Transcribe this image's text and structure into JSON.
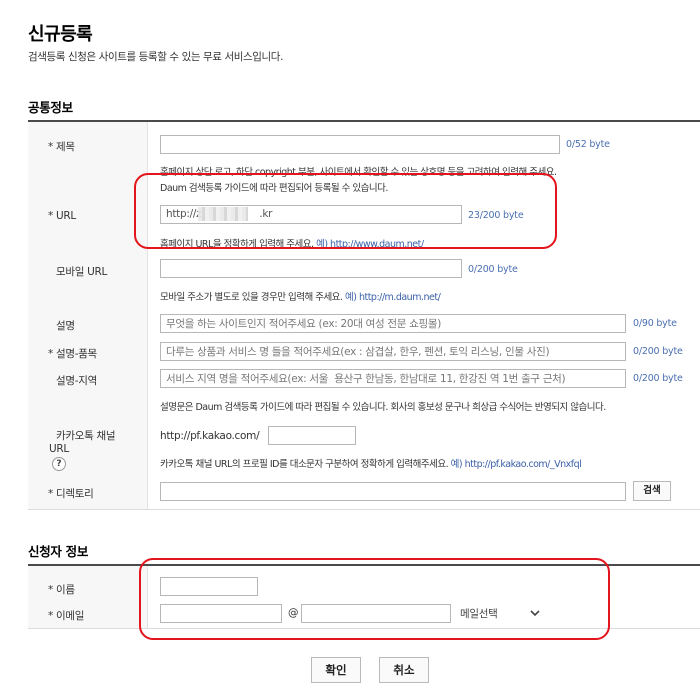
{
  "page": {
    "title": "신규등록",
    "subtitle": "검색등록 신청은 사이트를 등록할 수 있는 무료 서비스입니다."
  },
  "common": {
    "section_title": "공통정보",
    "title_field": {
      "label": "* 제목",
      "value": "",
      "counter": "0/52 byte",
      "help1": "홈페이지 상단 로고, 하단 copyright 부분, 사이트에서 확인할 수 있는 상호명 등을 고려하여 입력해 주세요.",
      "help2": "Daum 검색등록 가이드에 따라 편집되어 등록될 수 있습니다."
    },
    "url_field": {
      "label": "* URL",
      "value_prefix": "http://z",
      "value_suffix": ".kr",
      "counter": "23/200 byte",
      "help_text": "홈페이지 URL을 정확하게 입력해 주세요.",
      "help_link": "예) http://www.daum.net/"
    },
    "mobile_url_field": {
      "label": "모바일 URL",
      "value": "",
      "counter": "0/200 byte",
      "help_text": "모바일 주소가 별도로 있을 경우만 입력해 주세요.",
      "help_link": "예) http://m.daum.net/"
    },
    "desc_field": {
      "label": "설명",
      "placeholder": "무엇을 하는 사이트인지 적어주세요 (ex: 20대 여성 전문 쇼핑몰)",
      "counter": "0/90 byte"
    },
    "desc_product_field": {
      "label": "* 설명-품목",
      "placeholder": "다루는 상품과 서비스 명 들을 적어주세요(ex : 삼겹살, 한우, 펜션, 토익 리스닝, 인물 사진)",
      "counter": "0/200 byte"
    },
    "desc_region_field": {
      "label": "설명-지역",
      "placeholder": "서비스 지역 명을 적어주세요(ex: 서울  용산구 한남동, 한남대로 11, 한강진 역 1번 출구 근처)",
      "counter": "0/200 byte",
      "help": "설명문은 Daum 검색등록 가이드에 따라 편집될 수 있습니다. 회사의 홍보성 문구나 희상급 수식어는 반영되지 않습니다."
    },
    "kakao_field": {
      "label_line1": "카카오톡 채널",
      "label_line2": "URL",
      "help_icon": "?",
      "prefix": "http://pf.kakao.com/",
      "value": "",
      "help_text": "카카오톡 채널 URL의 프로필 ID를 대소문자 구분하여 정확하게 입력해주세요.",
      "help_link": "예) http://pf.kakao.com/_Vnxfql"
    },
    "directory_field": {
      "label": "* 디렉토리",
      "value": "",
      "search_label": "검색"
    }
  },
  "applicant": {
    "section_title": "신청자 정보",
    "name_field": {
      "label": "* 이름",
      "value": ""
    },
    "email_field": {
      "label": "* 이메일",
      "local_value": "",
      "at": "@",
      "domain_value": "",
      "select_label": "메일선택",
      "select_icon": "chevron-down-icon"
    }
  },
  "actions": {
    "confirm_label": "확인",
    "cancel_label": "취소"
  },
  "colors": {
    "highlight": "#e3141b",
    "link": "#3a5fa8",
    "counter": "#4a6fb0",
    "label_bg": "#f7f7f7",
    "rule": "#4a4a4a"
  }
}
